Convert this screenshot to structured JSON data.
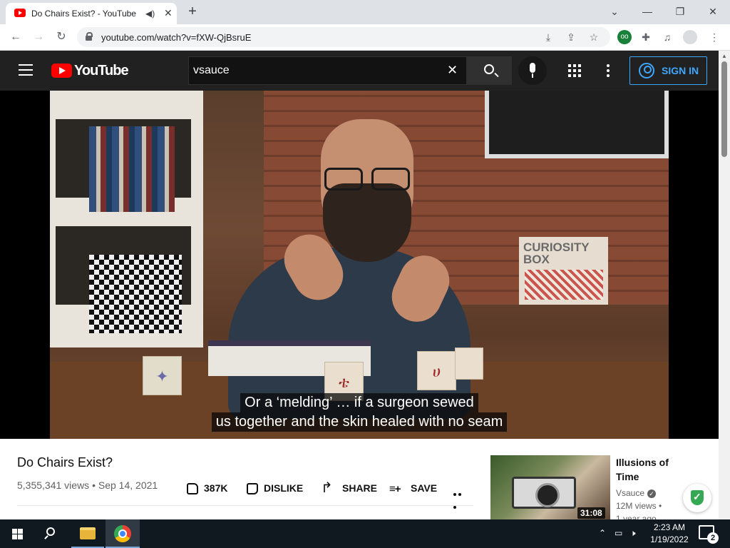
{
  "browser": {
    "tab_title": "Do Chairs Exist? - YouTube",
    "new_tab_symbol": "+",
    "url": "youtube.com/watch?v=fXW-QjBsruE",
    "window_controls": {
      "chevron": "⌄",
      "minimize": "—",
      "restore": "❐",
      "close": "✕"
    },
    "nav": {
      "back": "←",
      "forward": "→",
      "reload": "↻"
    },
    "omnibox_icons": {
      "install": "⤓",
      "share": "⇪",
      "bookmark": "☆"
    },
    "extensions": {
      "badge": "oo",
      "puzzle": "✚",
      "media": "♫",
      "menu": "⋮"
    }
  },
  "youtube": {
    "logo_text": "YouTube",
    "search": {
      "value": "vsauce",
      "clear": "✕"
    },
    "sign_in_label": "SIGN IN"
  },
  "video": {
    "captions": [
      "Or a ‘melding’ … if a surgeon sewed",
      "us together and the skin healed with no seam"
    ],
    "scene_labels": {
      "box_text": "CURIOSITY\nBOX"
    },
    "title": "Do Chairs Exist?",
    "views": "5,355,341 views",
    "date": "Sep 14, 2021",
    "actions": {
      "like_count": "387K",
      "dislike_label": "DISLIKE",
      "share_label": "SHARE",
      "save_label": "SAVE"
    }
  },
  "recommendation": {
    "title": "Illusions of Time",
    "channel": "Vsauce",
    "verified_mark": "✓",
    "views": "12M views •",
    "age": "1 year ago",
    "duration": "31:08"
  },
  "taskbar": {
    "tray_chevron": "⌃",
    "tray_icons": {
      "network": "▭",
      "volume": "🕨"
    },
    "time": "2:23 AM",
    "date": "1/19/2022",
    "notifications_count": "2"
  }
}
